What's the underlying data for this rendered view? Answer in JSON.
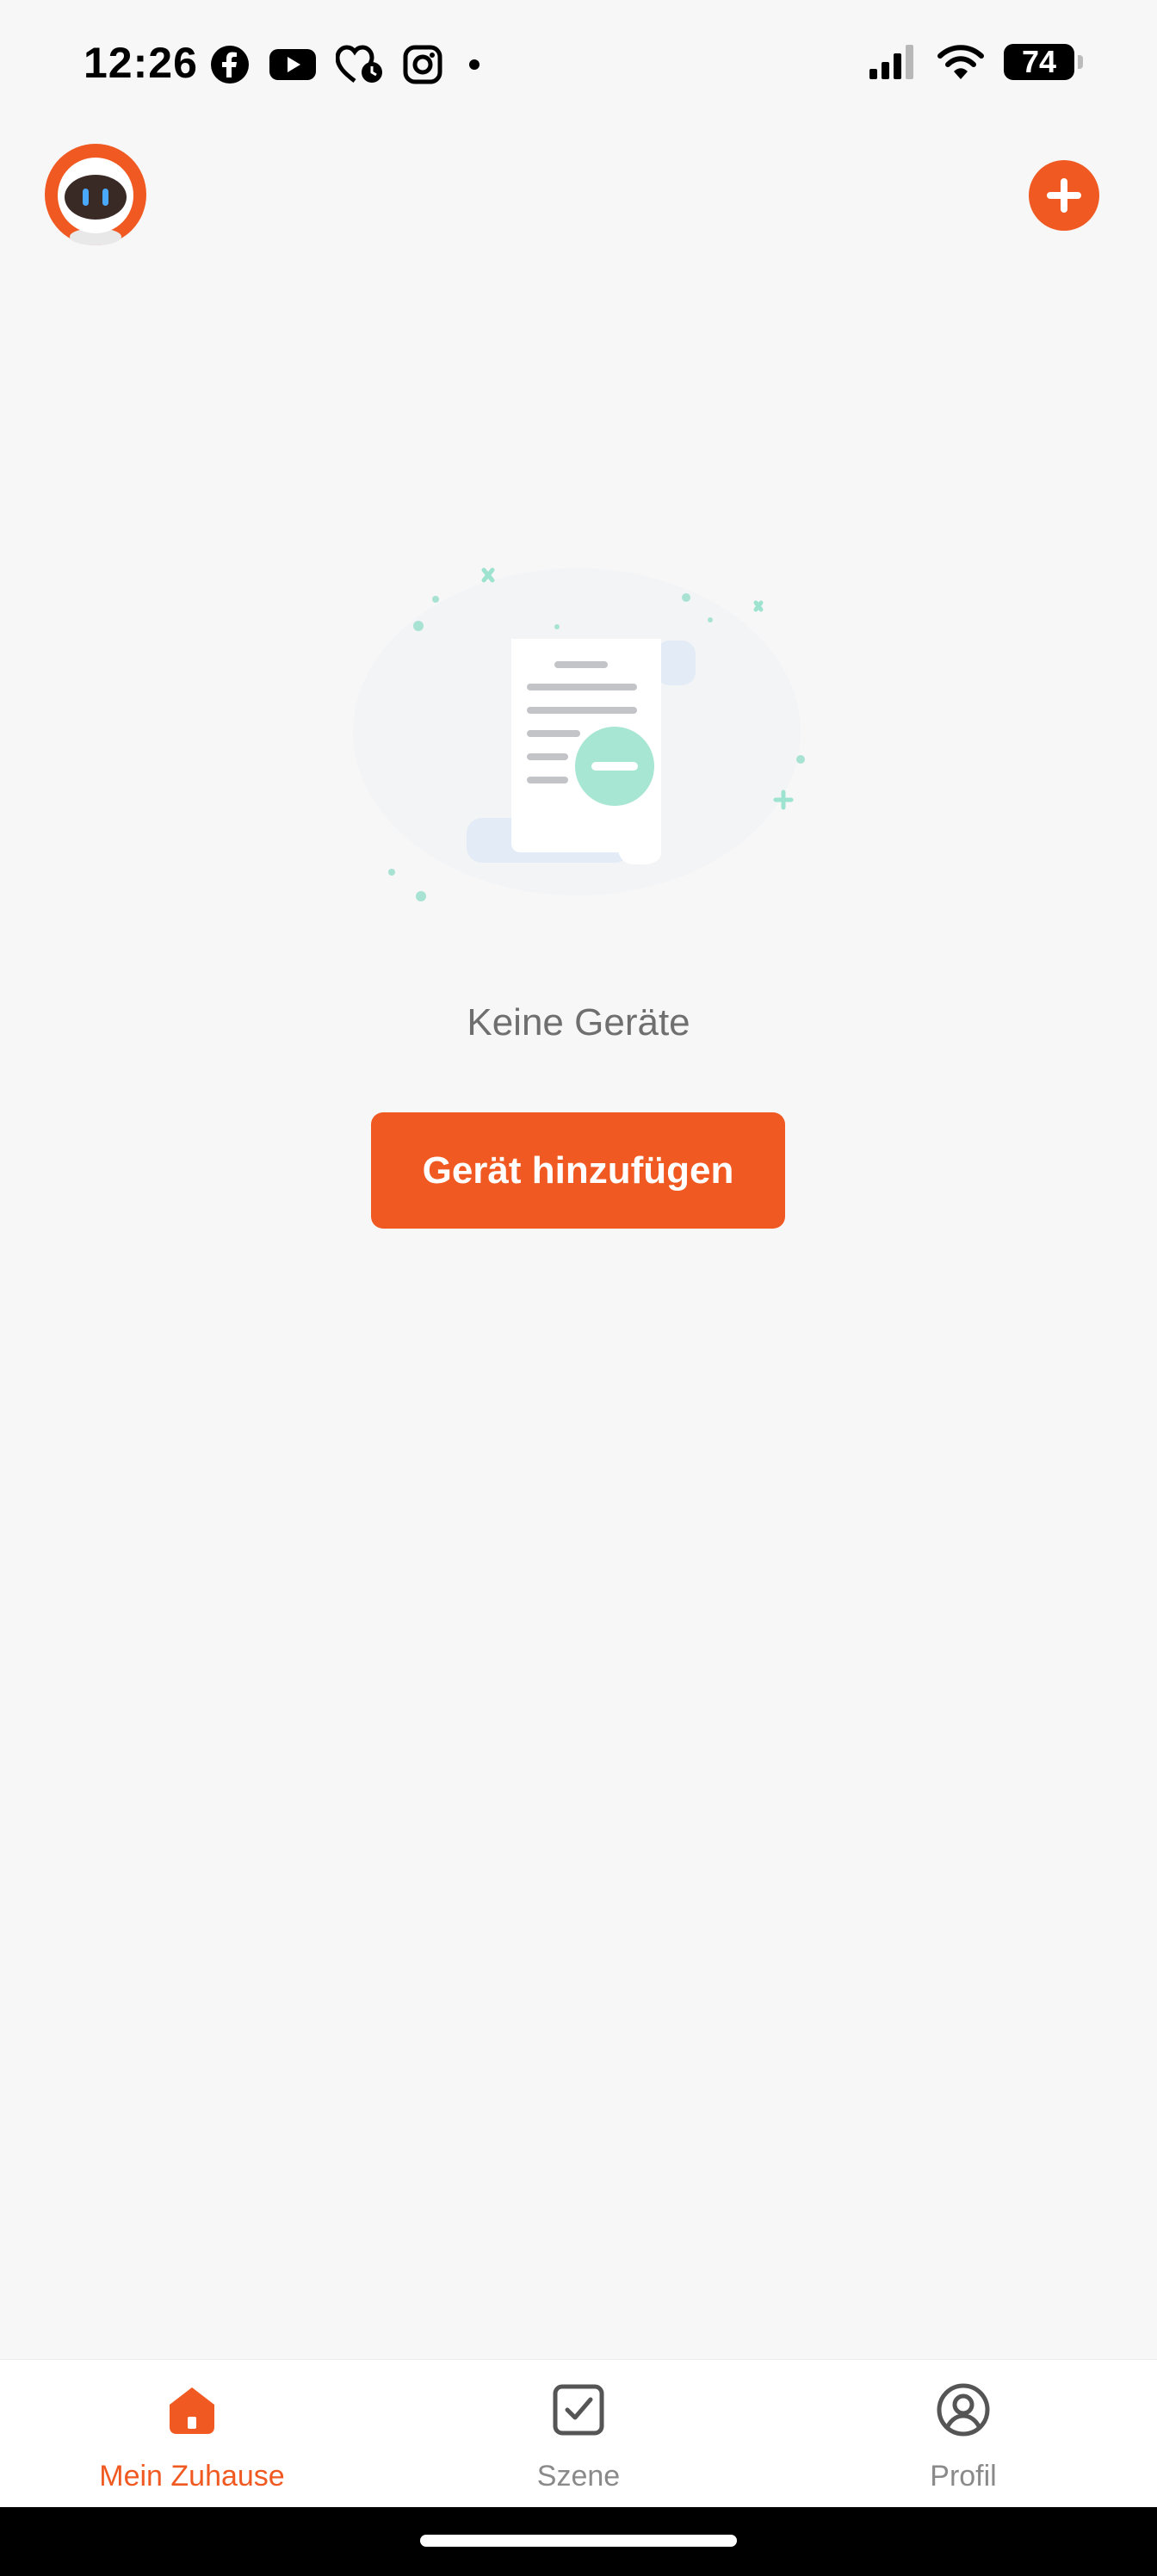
{
  "status_bar": {
    "time": "12:26",
    "battery_level": "74",
    "app_icons": [
      "facebook-icon",
      "youtube-icon",
      "health-clock-icon",
      "instagram-icon",
      "dot-icon"
    ],
    "system_icons": [
      "cellular-signal-icon",
      "wifi-icon",
      "battery-icon"
    ]
  },
  "header": {
    "avatar_icon": "robot-avatar-icon",
    "add_icon": "plus-icon"
  },
  "empty_state": {
    "illustration_icon": "empty-document-icon",
    "message": "Keine Geräte",
    "button_label": "Gerät hinzufügen"
  },
  "tabs": [
    {
      "label": "Mein Zuhause",
      "icon": "home-icon",
      "active": true
    },
    {
      "label": "Szene",
      "icon": "checkbox-icon",
      "active": false
    },
    {
      "label": "Profil",
      "icon": "profile-icon",
      "active": false
    }
  ],
  "colors": {
    "accent": "#f05a22",
    "background": "#f7f7f8",
    "inactive": "#8a8a8a"
  }
}
